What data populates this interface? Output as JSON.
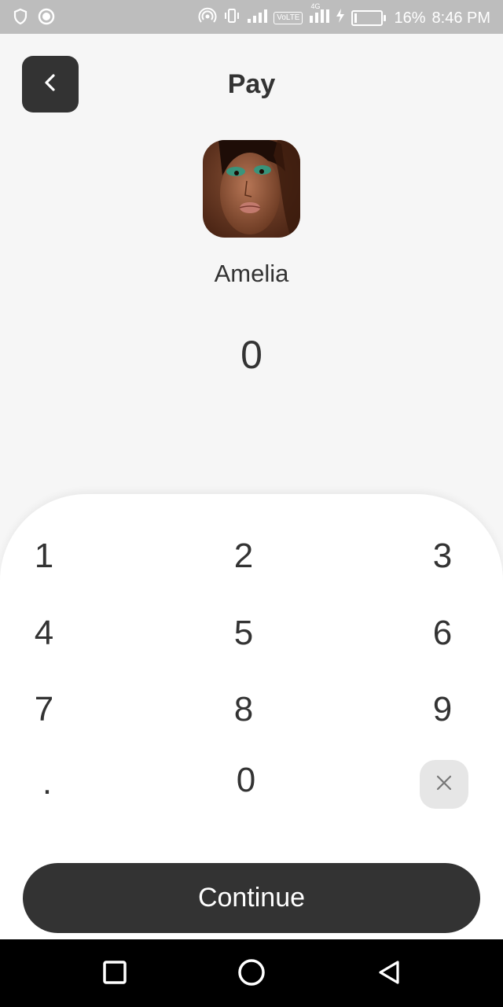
{
  "status_bar": {
    "battery_percent": "16%",
    "time": "8:46 PM",
    "network_label": "VoLTE",
    "network_type": "4G",
    "icons": [
      "shield-icon",
      "record-icon",
      "hotspot-icon",
      "vibrate-icon",
      "signal-icon",
      "volte-icon",
      "signal-4g-icon",
      "charging-icon",
      "battery-icon"
    ]
  },
  "header": {
    "title": "Pay",
    "back_icon": "chevron-left-icon"
  },
  "recipient": {
    "name": "Amelia",
    "avatar": "avatar-photo"
  },
  "amount": {
    "value": "0"
  },
  "keypad": {
    "keys": [
      "1",
      "2",
      "3",
      "4",
      "5",
      "6",
      "7",
      "8",
      "9",
      ".",
      "0"
    ],
    "delete_icon": "close-icon"
  },
  "continue_button": {
    "label": "Continue"
  },
  "nav_bar": {
    "icons": [
      "recent-apps-icon",
      "home-icon",
      "back-triangle-icon"
    ]
  },
  "colors": {
    "background": "#f6f6f6",
    "dark": "#333333",
    "status_bar": "#bdbdbd",
    "delete_key_bg": "#e6e6e6",
    "nav_bar": "#000000"
  }
}
